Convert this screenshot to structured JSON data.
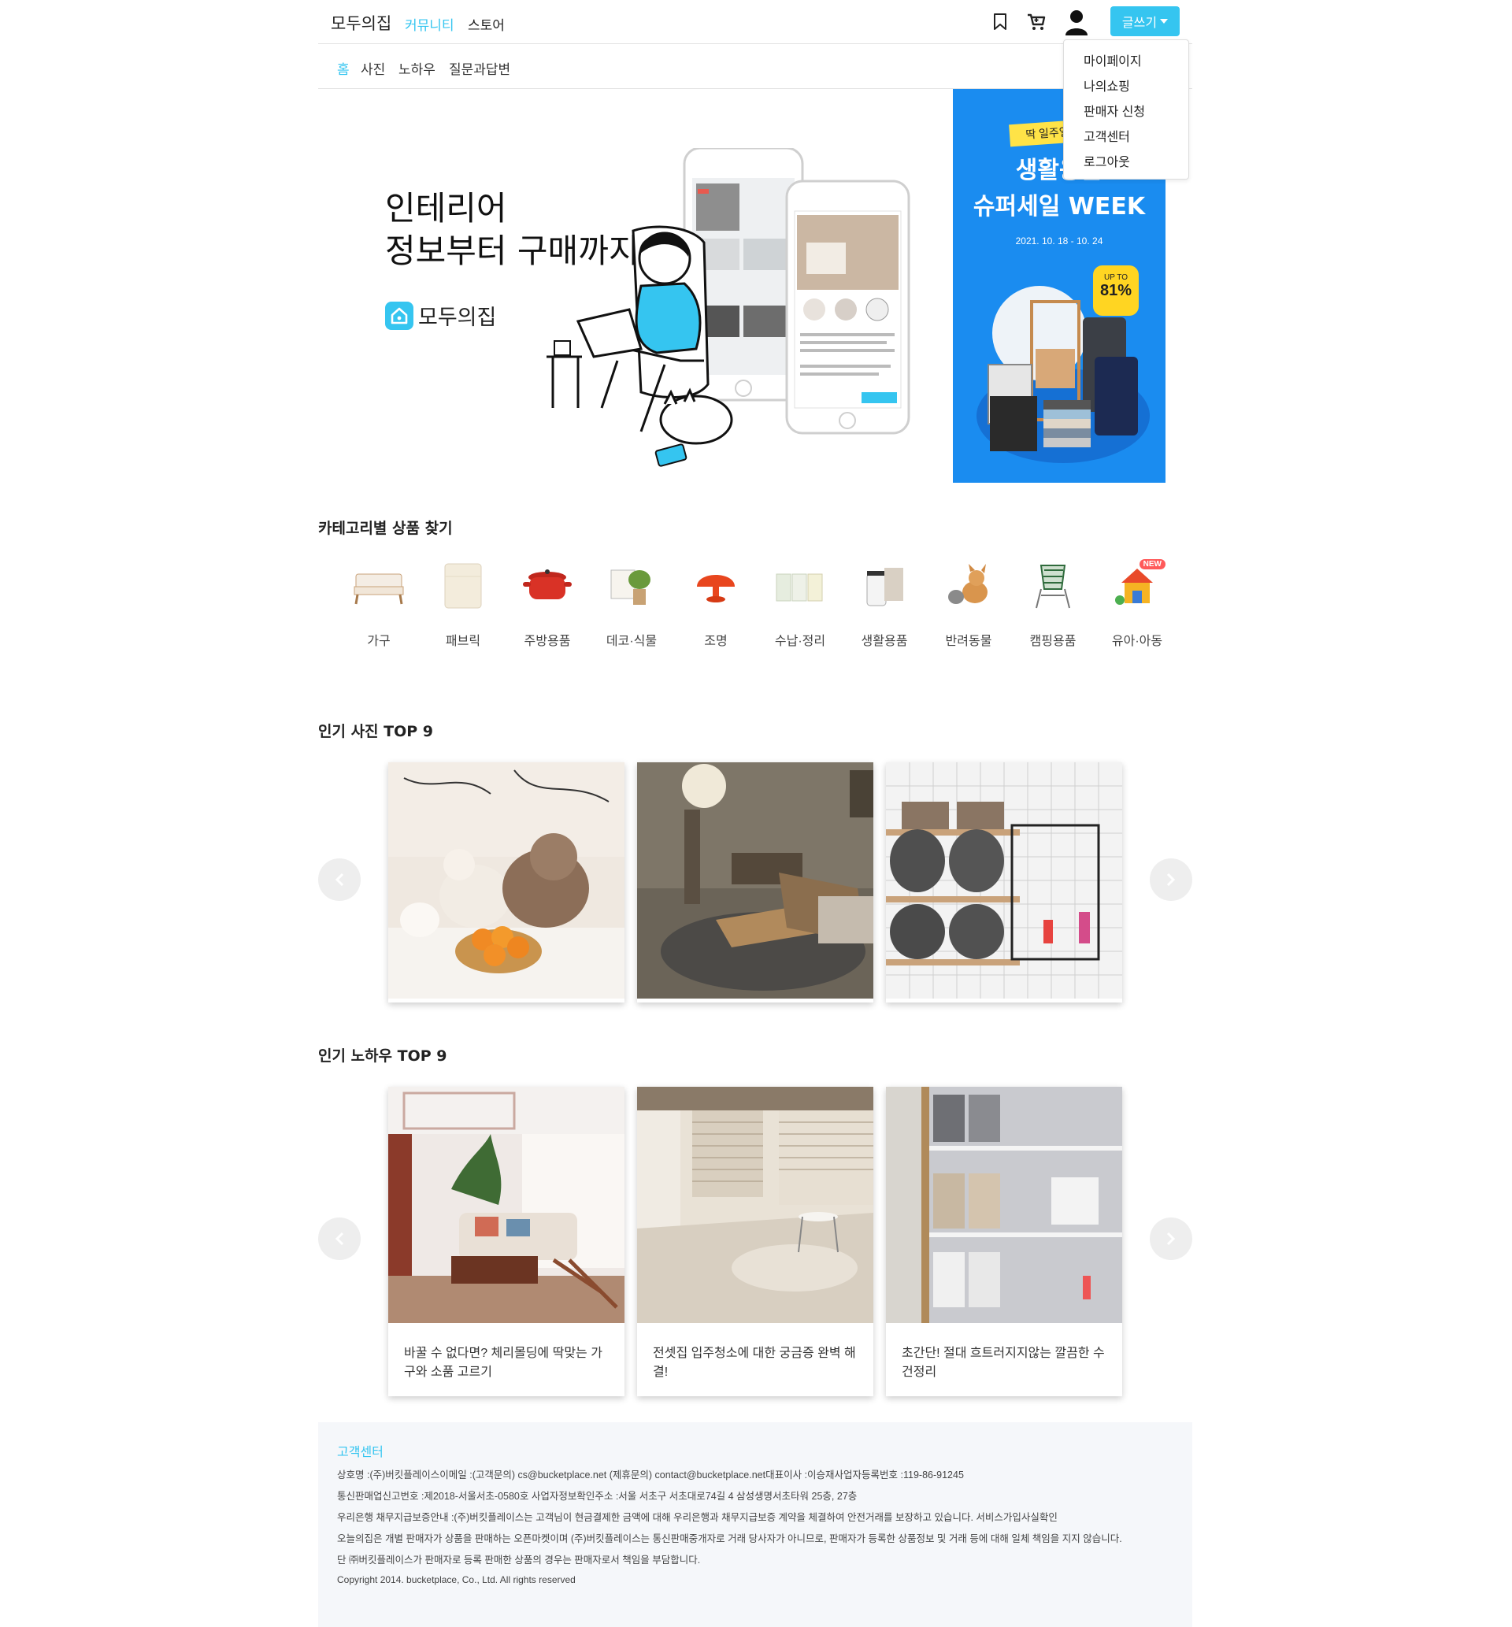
{
  "header": {
    "logo": "모두의집",
    "nav": [
      "커뮤니티",
      "스토어"
    ],
    "write_label": "글쓰기"
  },
  "subnav": {
    "items": [
      "홈",
      "사진",
      "노하우",
      "질문과답변"
    ]
  },
  "dropdown": {
    "items": [
      "마이페이지",
      "나의쇼핑",
      "판매자 신청",
      "고객센터",
      "로그아웃"
    ]
  },
  "hero": {
    "title_line1": "인테리어",
    "title_line2": "정보부터 구매까지",
    "brand": "모두의집"
  },
  "side_banner": {
    "tag": "딱 일주일",
    "title_line1": "생활용품",
    "title_line2": "슈퍼세일 WEEK",
    "date": "2021. 10. 18 - 10. 24",
    "badge_top": "UP TO",
    "badge_value": "81%",
    "bg_color": "#1a8cf0"
  },
  "categories": {
    "title": "카테고리별 상품 찾기",
    "items": [
      {
        "label": "가구",
        "icon": "sofa-icon"
      },
      {
        "label": "패브릭",
        "icon": "bedding-icon"
      },
      {
        "label": "주방용품",
        "icon": "pot-icon"
      },
      {
        "label": "데코·식물",
        "icon": "plant-icon"
      },
      {
        "label": "조명",
        "icon": "lamp-icon"
      },
      {
        "label": "수납·정리",
        "icon": "storage-box-icon"
      },
      {
        "label": "생활용품",
        "icon": "trash-bin-icon"
      },
      {
        "label": "반려동물",
        "icon": "dog-icon"
      },
      {
        "label": "캠핑용품",
        "icon": "camping-chair-icon"
      },
      {
        "label": "유아·아동",
        "icon": "toy-house-icon",
        "badge": "NEW"
      }
    ]
  },
  "photos": {
    "title": "인기 사진 TOP 9",
    "cards": [
      {
        "image": "bedroom-plush-toys-photo"
      },
      {
        "image": "dim-living-room-photo"
      },
      {
        "image": "bathroom-towel-shelf-photo"
      }
    ]
  },
  "knowhow": {
    "title": "인기 노하우 TOP 9",
    "cards": [
      {
        "image": "living-room-sofa-photo",
        "text": "바꿀 수 없다면? 체리몰딩에 딱맞는 가구와 소품 고르기"
      },
      {
        "image": "bright-apartment-photo",
        "text": "전셋집 입주청소에 대한 궁금증 완벽 해결!"
      },
      {
        "image": "towel-closet-photo",
        "text": "초간단! 절대 흐트러지지않는 깔끔한 수건정리"
      }
    ]
  },
  "footer": {
    "title": "고객센터",
    "lines": [
      "상호명 :(주)버킷플레이스이메일 :(고객문의) cs@bucketplace.net (제휴문의) contact@bucketplace.net대표이사 :이승재사업자등록번호 :119-86-91245",
      "통신판매업신고번호 :제2018-서울서초-0580호 사업자정보확인주소 :서울 서초구 서초대로74길 4 삼성생명서초타워 25층, 27층",
      "우리은행 채무지급보증안내 :(주)버킷플레이스는 고객님이 현금결제한 금액에 대해 우리은행과 채무지급보증 계약을 체결하여 안전거래를 보장하고 있습니다. 서비스가입사실확인",
      "오늘의집은 개별 판매자가 상품을 판매하는 오픈마켓이며 (주)버킷플레이스는 통신판매중개자로 거래 당사자가 아니므로, 판매자가 등록한 상품정보 및 거래 등에 대해 일체 책임을 지지 않습니다.",
      "단 ㈜버킷플레이스가 판매자로 등록 판매한 상품의 경우는 판매자로서 책임을 부담합니다."
    ],
    "copyright": "Copyright 2014. bucketplace, Co., Ltd. All rights reserved"
  },
  "colors": {
    "accent": "#35c5f0",
    "footer_bg": "#f5f7fa"
  }
}
